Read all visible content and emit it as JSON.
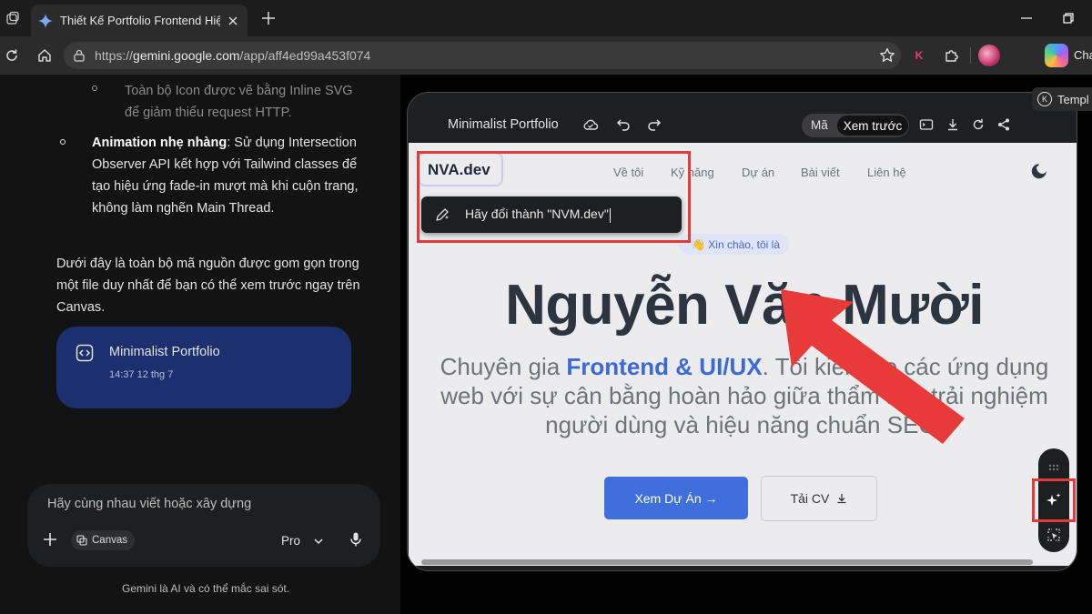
{
  "browser": {
    "tab_title": "Thiết Kế Portfolio Frontend Hiện Đ",
    "url_prefix": "https://",
    "url_host": "gemini.google.com",
    "url_path": "/app/aff4ed99a453f074",
    "extension_k": "K",
    "copilot_label": "Cha",
    "template_label": "Templ",
    "template_badge": "K"
  },
  "chat": {
    "sub_bullet_text": "Toàn bộ Icon được vẽ bằng Inline SVG để giảm thiểu request HTTP.",
    "bullet_bold": "Animation nhẹ nhàng",
    "bullet_text": ": Sử dụng Intersection Observer API kết hợp với Tailwind classes để tạo hiệu ứng fade-in mượt mà khi cuộn trang, không làm nghẽn Main Thread.",
    "paragraph": "Dưới đây là toàn bộ mã nguồn được gom gọn trong một file duy nhất để bạn có thể xem trước ngay trên Canvas.",
    "canvas_card": {
      "name": "Minimalist Portfolio",
      "time": "14:37 12 thg 7"
    },
    "input_placeholder": "Hãy cùng nhau viết hoặc xây dựng",
    "canvas_chip": "Canvas",
    "model": "Pro",
    "disclaimer": "Gemini là AI và có thể mắc sai sót."
  },
  "preview": {
    "title": "Minimalist Portfolio",
    "toggle_code": "Mã",
    "toggle_preview": "Xem trước",
    "site": {
      "brand": "NVA.dev",
      "nav": [
        "Về tôi",
        "Kỹ năng",
        "Dự án",
        "Bài viết",
        "Liên hệ"
      ],
      "edit_prompt": "Hãy đổi thành \"NVM.dev\"",
      "hello": "👋 Xin chào, tôi là",
      "name": "Nguyễn Văn Mười",
      "desc_before": "Chuyên gia ",
      "desc_highlight": "Frontend & UI/UX",
      "desc_after": ". Tôi kiến tạo các ứng dụng web với sự cân bằng hoàn hảo giữa thẩm mỹ, trải nghiệm người dùng và hiệu năng chuẩn SEO.",
      "btn_projects": "Xem Dự Án →",
      "btn_cv": "Tải CV"
    }
  },
  "colors": {
    "annotation": "#e23b3b",
    "accent_blue": "#3e6fdc",
    "canvas_card": "#1c2f6e"
  },
  "icons": [
    "workspaces-icon",
    "gemini-favicon",
    "close-icon",
    "plus-icon",
    "reload-icon",
    "home-icon",
    "lock-icon",
    "star-icon",
    "puzzle-icon",
    "code-icon",
    "cloud-icon",
    "undo-icon",
    "redo-icon",
    "terminal-icon",
    "download-icon",
    "refresh-icon",
    "share-icon",
    "moon-icon",
    "pen-sparkle-icon",
    "sparkle-icon",
    "select-icon",
    "mic-icon",
    "chevron-down-icon",
    "arrow-annotation"
  ]
}
